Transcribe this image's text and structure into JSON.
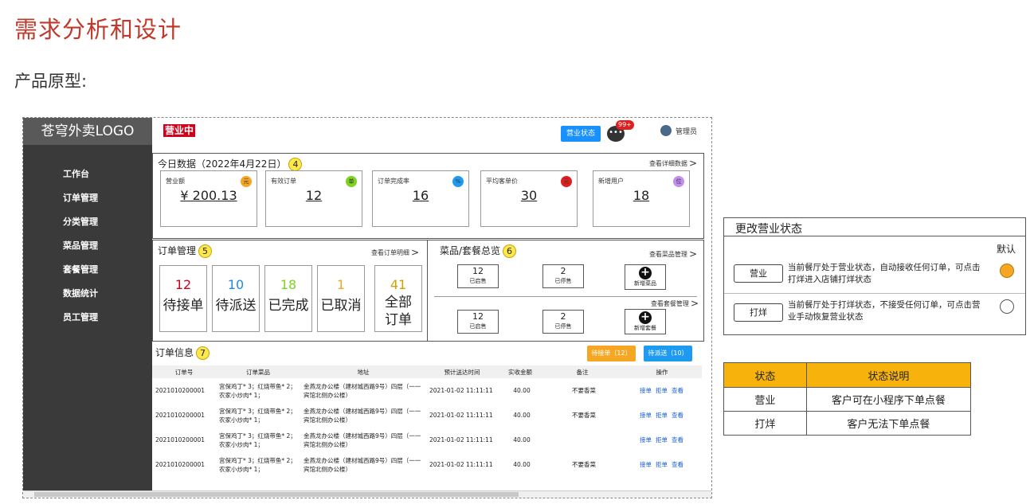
{
  "slide": {
    "title": "需求分析和设计",
    "subtitle": "产品原型:"
  },
  "sidebar": {
    "logo": "苍穹外卖LOGO",
    "items": [
      {
        "label": "工作台"
      },
      {
        "label": "订单管理"
      },
      {
        "label": "分类管理"
      },
      {
        "label": "菜品管理"
      },
      {
        "label": "套餐管理"
      },
      {
        "label": "数据统计"
      },
      {
        "label": "员工管理"
      }
    ]
  },
  "topbar": {
    "status_tag": "营业中",
    "status_button": "营业状态",
    "message_icon": "chat-bubble-icon",
    "message_badge": "99+",
    "admin_label": "管理员"
  },
  "today": {
    "title": "今日数据（2022年4月22日）",
    "marker": "4",
    "detail_link": "查看详细数据",
    "kpis": [
      {
        "label": "营业额",
        "value": "¥ 200.13",
        "icon": "元",
        "color": "#f5a623"
      },
      {
        "label": "有效订单",
        "value": "12",
        "icon": "单",
        "color": "#7ed321"
      },
      {
        "label": "订单完成率",
        "value": "16",
        "icon": "%",
        "color": "#1e9bf0"
      },
      {
        "label": "平均客单价",
        "value": "30",
        "icon": "元",
        "color": "#e02020"
      },
      {
        "label": "新增用户",
        "value": "18",
        "icon": "位",
        "color": "#c58ef0"
      }
    ]
  },
  "order_mgmt": {
    "title": "订单管理",
    "marker": "5",
    "detail_link": "查看订单明细",
    "stats": [
      {
        "num": "12",
        "label": "待接单",
        "color": "#d0021b"
      },
      {
        "num": "10",
        "label": "待派送",
        "color": "#1e88e5"
      },
      {
        "num": "18",
        "label": "已完成",
        "color": "#7ed321"
      },
      {
        "num": "1",
        "label": "已取消",
        "color": "#f5a623"
      },
      {
        "num": "41",
        "label": "全部订单",
        "color": "#c9a400"
      }
    ]
  },
  "dish_overview": {
    "title": "菜品/套餐总览",
    "marker": "6",
    "dish_link": "查看菜品管理",
    "combo_link": "查看套餐管理",
    "dish": {
      "on_num": "12",
      "on_label": "已启售",
      "off_num": "2",
      "off_label": "已停售",
      "add_label": "新增菜品"
    },
    "combo": {
      "on_num": "12",
      "on_label": "已启售",
      "off_num": "2",
      "off_label": "已停售",
      "add_label": "新增套餐"
    }
  },
  "order_info": {
    "title": "订单信息",
    "marker": "7",
    "btn_pending": "待接单（12）",
    "btn_delivery": "待派送（10）",
    "columns": [
      "订单号",
      "订单菜品",
      "地址",
      "预计送达时间",
      "实收金额",
      "备注",
      "操作"
    ],
    "rows": [
      {
        "id": "2021010200001",
        "dishes": "宫保鸡丁* 3；红烧带鱼* 2；农家小炒肉* 1；",
        "address": "金燕龙办公楼（建材城西路9号）四层（一一宾馆北侧办公楼）",
        "time": "2021-01-02 11:11:11",
        "amount": "40.00",
        "note": "不要香菜"
      },
      {
        "id": "2021010200001",
        "dishes": "宫保鸡丁* 3；红烧带鱼* 2；农家小炒肉* 1；",
        "address": "金燕龙办公楼（建材城西路9号）四层（一一宾馆北侧办公楼）",
        "time": "2021-01-02 11:11:11",
        "amount": "40.00",
        "note": "不要香菜"
      },
      {
        "id": "2021010200001",
        "dishes": "宫保鸡丁* 3；红烧带鱼* 2；农家小炒肉* 1；",
        "address": "金燕龙办公楼（建材城西路9号）四层（一一宾馆北侧办公楼）",
        "time": "2021-01-02 11:11:11",
        "amount": "40.00",
        "note": ""
      },
      {
        "id": "2021010200001",
        "dishes": "宫保鸡丁* 3；红烧带鱼* 2；农家小炒肉* 1；",
        "address": "金燕龙办公楼（建材城西路9号）四层（一一宾馆北侧办公楼）",
        "time": "2021-01-02 11:11:11",
        "amount": "40.00",
        "note": "不要香菜"
      }
    ],
    "actions": [
      "接单",
      "拒单",
      "查看"
    ]
  },
  "status_dialog": {
    "title": "更改营业状态",
    "default_label": "默认",
    "options": [
      {
        "button": "营业",
        "desc": "当前餐厅处于营业状态，自动接收任何订单，可点击打烊进入店铺打烊状态",
        "selected": true
      },
      {
        "button": "打烊",
        "desc": "当前餐厅处于打烊状态，不接受任何订单，可点击营业手动恢复营业状态",
        "selected": false
      }
    ]
  },
  "status_table": {
    "headers": [
      "状态",
      "状态说明"
    ],
    "rows": [
      [
        "营业",
        "客户可在小程序下单点餐"
      ],
      [
        "打烊",
        "客户无法下单点餐"
      ]
    ],
    "header_color": "#f7b30b"
  }
}
